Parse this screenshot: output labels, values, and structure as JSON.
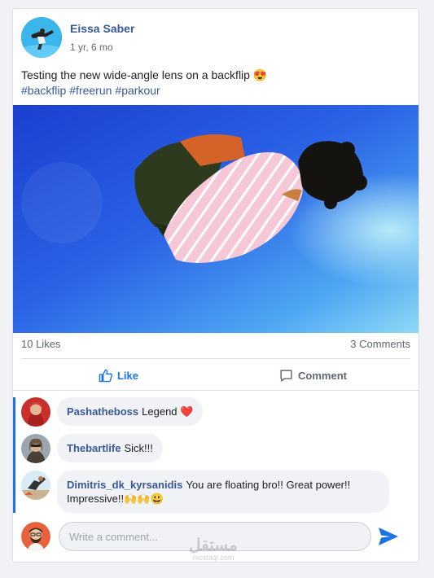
{
  "post": {
    "author": "Eissa Saber",
    "time": "1 yr, 6 mo",
    "text": "Testing the new wide-angle lens on a backflip 😍",
    "hashtags": [
      "#backflip",
      "#freerun",
      "#parkour"
    ],
    "image_icon": "backflip-photo"
  },
  "stats": {
    "likes": "10 Likes",
    "comments": "3 Comments"
  },
  "actions": {
    "like_label": "Like",
    "comment_label": "Comment"
  },
  "comments": [
    {
      "author": "Pashatheboss",
      "text": "Legend ❤️"
    },
    {
      "author": "Thebartlife",
      "text": "Sick!!!"
    },
    {
      "author": "Dimitris_dk_kyrsanidis",
      "text": "You are floating bro!! Great power!! Impressive!!🙌🙌😃"
    }
  ],
  "composer": {
    "placeholder": "Write a comment..."
  },
  "watermark": {
    "main": "مستقل",
    "sub": "mostaql.com"
  },
  "colors": {
    "accent": "#1b74e4",
    "link": "#385898",
    "heart": "#e0245e"
  }
}
